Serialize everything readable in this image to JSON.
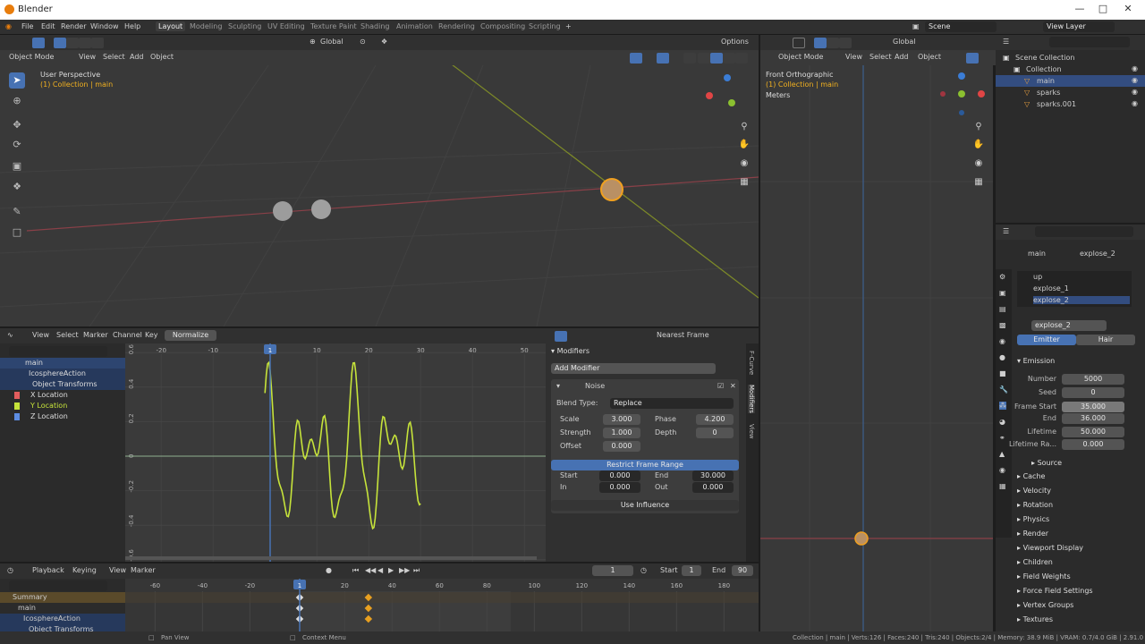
{
  "window": {
    "title": "Blender"
  },
  "menu": [
    "File",
    "Edit",
    "Render",
    "Window",
    "Help"
  ],
  "workspaces": [
    "Layout",
    "Modeling",
    "Sculpting",
    "UV Editing",
    "Texture Paint",
    "Shading",
    "Animation",
    "Rendering",
    "Compositing",
    "Scripting"
  ],
  "active_workspace": "Layout",
  "scene": {
    "name": "Scene",
    "view_layer": "View Layer"
  },
  "viewport_left": {
    "mode": "Object Mode",
    "menus": [
      "View",
      "Select",
      "Add",
      "Object"
    ],
    "orientation": "Global",
    "options": "Options",
    "title": "User Perspective",
    "collection": "(1) Collection | main"
  },
  "viewport_right": {
    "mode": "Object Mode",
    "menus": [
      "View",
      "Select",
      "Add",
      "Object"
    ],
    "orientation": "Global",
    "title": "Front Orthographic",
    "collection": "(1) Collection | main",
    "units": "Meters"
  },
  "outliner": {
    "rows": [
      {
        "label": "Scene Collection",
        "indent": 0
      },
      {
        "label": "Collection",
        "indent": 1
      },
      {
        "label": "main",
        "indent": 2,
        "selected": true
      },
      {
        "label": "sparks",
        "indent": 2
      },
      {
        "label": "sparks.001",
        "indent": 2
      }
    ]
  },
  "properties": {
    "object": "main",
    "particle_system": "explose_2",
    "systems": [
      "up",
      "explose_1",
      "explose_2"
    ],
    "system_name": "explose_2",
    "tabs": [
      "Emitter",
      "Hair"
    ],
    "emission": {
      "title": "Emission",
      "number_label": "Number",
      "number": "5000",
      "seed_label": "Seed",
      "seed": "0",
      "frame_start_label": "Frame Start",
      "frame_start": "35.000",
      "end_label": "End",
      "end": "36.000",
      "lifetime_label": "Lifetime",
      "lifetime": "50.000",
      "lifetime_random_label": "Lifetime Ra...",
      "lifetime_random": "0.000"
    },
    "source": "Source",
    "sections": [
      "Cache",
      "Velocity",
      "Rotation",
      "Physics",
      "Render",
      "Viewport Display",
      "Children",
      "Field Weights",
      "Force Field Settings",
      "Vertex Groups",
      "Textures"
    ]
  },
  "graph_editor": {
    "menus": [
      "View",
      "Select",
      "Marker",
      "Channel",
      "Key"
    ],
    "normalize": "Normalize",
    "snap": "Nearest Frame",
    "current_frame": "1",
    "channels": [
      {
        "label": "main",
        "color": "#ddd"
      },
      {
        "label": "IcosphereAction",
        "color": "#ddd"
      },
      {
        "label": "Object Transforms",
        "color": "#ddd"
      },
      {
        "label": "X Location",
        "color": "#e35d5d"
      },
      {
        "label": "Y Location",
        "color": "#c6e33a"
      },
      {
        "label": "Z Location",
        "color": "#5d8de3"
      }
    ],
    "x_ticks": [
      "-20",
      "-10",
      "1",
      "10",
      "20",
      "30",
      "40",
      "50"
    ],
    "y_ticks": [
      "0.6",
      "0.4",
      "0.2",
      "0",
      "-0.2",
      "-0.4",
      "-0.6"
    ],
    "side_tabs": [
      "F-Curve",
      "Modifiers",
      "View"
    ]
  },
  "modifiers": {
    "title": "Modifiers",
    "add": "Add Modifier",
    "name": "Noise",
    "blend_type_label": "Blend Type:",
    "blend_type": "Replace",
    "scale_label": "Scale",
    "scale": "3.000",
    "phase_label": "Phase",
    "phase": "4.200",
    "strength_label": "Strength",
    "strength": "1.000",
    "depth_label": "Depth",
    "depth": "0",
    "offset_label": "Offset",
    "offset": "0.000",
    "restrict": "Restrict Frame Range",
    "start_label": "Start",
    "start": "0.000",
    "end_label": "End",
    "end": "30.000",
    "in_label": "In",
    "in": "0.000",
    "out_label": "Out",
    "out": "0.000",
    "use_influence": "Use Influence"
  },
  "timeline": {
    "menus": [
      "Playback",
      "Keying",
      "View",
      "Marker"
    ],
    "current": "1",
    "start_label": "Start",
    "start": "1",
    "end_label": "End",
    "end": "90",
    "ticks": [
      "-60",
      "-40",
      "-20",
      "1",
      "20",
      "40",
      "60",
      "80",
      "100",
      "120",
      "140",
      "160",
      "180"
    ],
    "rows": [
      "Summary",
      "main",
      "IcosphereAction",
      "Object Transforms"
    ]
  },
  "status": {
    "pan": "Pan View",
    "context": "Context Menu",
    "info": "Collection | main | Verts:126 | Faces:240 | Tris:240 | Objects:2/4 | Memory: 38.9 MiB | VRAM: 0.7/4.0 GiB | 2.91.0"
  }
}
